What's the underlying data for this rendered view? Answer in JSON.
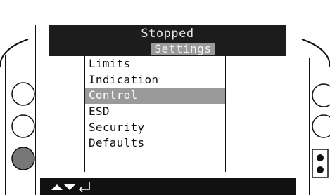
{
  "status": {
    "text": "Stopped"
  },
  "header": {
    "title": "Settings"
  },
  "menu": {
    "items": [
      {
        "label": "Limits"
      },
      {
        "label": "Indication"
      },
      {
        "label": "Control",
        "selected": true
      },
      {
        "label": "ESD"
      },
      {
        "label": "Security"
      },
      {
        "label": "Defaults"
      }
    ]
  },
  "nav": {
    "icons": [
      "up-arrow-icon",
      "down-arrow-icon",
      "enter-icon"
    ]
  },
  "colors": {
    "bar": "#1c1c1c",
    "highlight": "#9a9a9a",
    "indicator": "#777777"
  }
}
